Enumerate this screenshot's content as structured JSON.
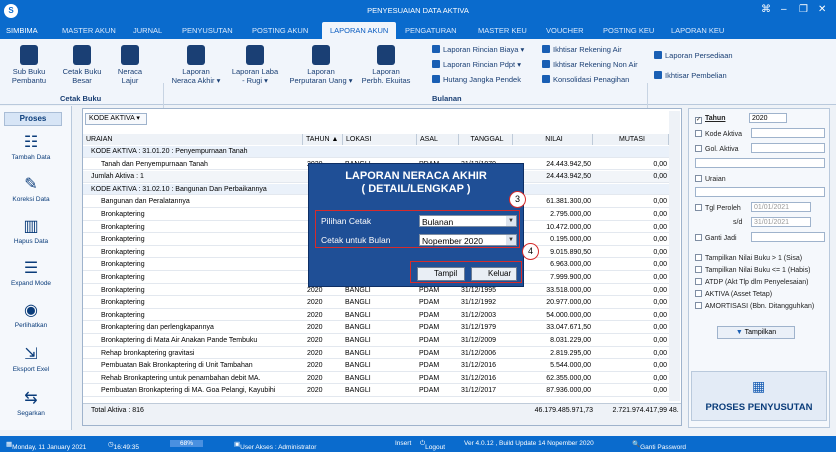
{
  "window": {
    "title": "PENYESUAIAN DATA AKTIVA",
    "logo": "S",
    "controls": [
      "⌘",
      "–",
      "❐",
      "✕"
    ]
  },
  "menu": [
    "SIMBIMA",
    "MASTER AKUN",
    "JURNAL",
    "PENYUSUTAN",
    "POSTING AKUN",
    "LAPORAN AKUN",
    "PENGATURAN",
    "MASTER KEU",
    "VOUCHER",
    "POSTING KEU",
    "LAPORAN KEU"
  ],
  "ribbon": {
    "buttons": [
      {
        "label": "Sub Buku\nPembantu"
      },
      {
        "label": "Cetak Buku\nBesar"
      },
      {
        "label": "Neraca\nLajur"
      },
      {
        "label": "Laporan\nNeraca Akhir ▾"
      },
      {
        "label": "Laporan Laba\n- Rugi ▾"
      },
      {
        "label": "Laporan\nPerputaran Uang ▾"
      },
      {
        "label": "Laporan\nPerbh. Ekuitas"
      }
    ],
    "group_cetak": "Cetak Buku",
    "group_bulanan": "Bulanan",
    "small": [
      "Laporan Rincian Biaya ▾",
      "Laporan Rincian Pdpt ▾",
      "Hutang Jangka Pendek",
      "Ikhtisar Rekening Air",
      "Ikhtisar Rekening Non Air",
      "Konsolidasi Penagihan",
      "Laporan Persediaan",
      "Ikhtisar Pembelian"
    ]
  },
  "left": {
    "title": "Proses",
    "buttons": [
      "Tambah Data",
      "Koreksi Data",
      "Hapus Data",
      "Expand Mode",
      "Perlihatkan",
      "Eksport Exel",
      "Segarkan"
    ]
  },
  "grid": {
    "group_by": "KODE AKTIVA",
    "headers": [
      "URAIAN",
      "TAHUN",
      "LOKASI",
      "ASAL",
      "TANGGAL",
      "NILAI",
      "MUTASI"
    ],
    "tahun_sort": "▲",
    "rows": [
      {
        "type": "group",
        "uraian": "KODE AKTIVA : 31.01.20 : Penyempurnaan Tanah"
      },
      {
        "type": "data",
        "uraian": "Tanah dan Penyempurnaan Tanah",
        "tahun": "2020",
        "lokasi": "BANGLI",
        "asal": "PDAM",
        "tanggal": "31/12/1979",
        "nilai": "24.443.942,50",
        "mutasi": "0,00"
      },
      {
        "type": "jml",
        "uraian": "Jumlah Aktiva : 1",
        "nilai": "24.443.942,50",
        "mutasi": "0,00"
      },
      {
        "type": "group",
        "uraian": "KODE AKTIVA : 31.02.10 : Bangunan Dan Perbaikannya"
      },
      {
        "type": "data",
        "uraian": "Bangunan dan Peralatannya",
        "nilai": "61.381.300,00",
        "mutasi": "0,00"
      },
      {
        "type": "data",
        "uraian": "Bronkaptering",
        "nilai": "2.795.000,00",
        "mutasi": "0,00"
      },
      {
        "type": "data",
        "uraian": "Bronkaptering",
        "nilai": "10.472.000,00",
        "mutasi": "0,00"
      },
      {
        "type": "data",
        "uraian": "Bronkaptering",
        "nilai": "0.195.000,00",
        "mutasi": "0,00"
      },
      {
        "type": "data",
        "uraian": "Bronkaptering",
        "nilai": "9.015.890,50",
        "mutasi": "0,00"
      },
      {
        "type": "data",
        "uraian": "Bronkaptering",
        "nilai": "6.963.000,00",
        "mutasi": "0,00"
      },
      {
        "type": "data",
        "uraian": "Bronkaptering",
        "nilai": "7.999.900,00",
        "mutasi": "0,00"
      },
      {
        "type": "data",
        "uraian": "Bronkaptering",
        "tahun": "2020",
        "lokasi": "BANGLI",
        "asal": "PDAM",
        "tanggal": "31/12/1995",
        "nilai": "33.518.000,00",
        "mutasi": "0,00"
      },
      {
        "type": "data",
        "uraian": "Bronkaptering",
        "tahun": "2020",
        "lokasi": "BANGLI",
        "asal": "PDAM",
        "tanggal": "31/12/1992",
        "nilai": "20.977.000,00",
        "mutasi": "0,00"
      },
      {
        "type": "data",
        "uraian": "Bronkaptering",
        "tahun": "2020",
        "lokasi": "BANGLI",
        "asal": "PDAM",
        "tanggal": "31/12/2003",
        "nilai": "54.000.000,00",
        "mutasi": "0,00"
      },
      {
        "type": "data",
        "uraian": "Bronkaptering dan perlengkapannya",
        "tahun": "2020",
        "lokasi": "BANGLI",
        "asal": "PDAM",
        "tanggal": "31/12/1979",
        "nilai": "33.047.671,50",
        "mutasi": "0,00"
      },
      {
        "type": "data",
        "uraian": "Bronkaptering di Mata Air Anakan Pande Tembuku",
        "tahun": "2020",
        "lokasi": "BANGLI",
        "asal": "PDAM",
        "tanggal": "31/12/2009",
        "nilai": "8.031.229,00",
        "mutasi": "0,00"
      },
      {
        "type": "data",
        "uraian": "Rehap bronkaptering gravitasi",
        "tahun": "2020",
        "lokasi": "BANGLI",
        "asal": "PDAM",
        "tanggal": "31/12/2006",
        "nilai": "2.819.295,00",
        "mutasi": "0,00"
      },
      {
        "type": "data",
        "uraian": "Pembuatan Bak Bronkaptering di Unit Tambahan",
        "tahun": "2020",
        "lokasi": "BANGLI",
        "asal": "PDAM",
        "tanggal": "31/12/2016",
        "nilai": "5.544.000,00",
        "mutasi": "0,00"
      },
      {
        "type": "data",
        "uraian": "Rehab Bronkaptering untuk penambahan debit MA.",
        "tahun": "2020",
        "lokasi": "BANGLI",
        "asal": "PDAM",
        "tanggal": "31/12/2016",
        "nilai": "62.355.000,00",
        "mutasi": "0,00"
      },
      {
        "type": "data",
        "uraian": "Pembuatan Bronkaptering di MA. Goa Pelangi, Kayubihi",
        "tahun": "2020",
        "lokasi": "BANGLI",
        "asal": "PDAM",
        "tanggal": "31/12/2017",
        "nilai": "87.936.000,00",
        "mutasi": "0,00"
      }
    ],
    "footer": {
      "total": "Total Aktiva : 816",
      "nilai": "46.179.485.971,73",
      "mutasi": "2.721.974.417,99",
      "extra": "48."
    }
  },
  "modal": {
    "title": "LAPORAN NERACA AKHIR\n( DETAIL/LENGKAP )",
    "label_cetak": "Pilihan Cetak",
    "value_cetak": "Bulanan",
    "label_bulan": "Cetak untuk Bulan",
    "value_bulan": "Nopember 2020",
    "btn_tampil": "Tampil",
    "btn_keluar": "Keluar",
    "callout_3": "3",
    "callout_4": "4"
  },
  "right": {
    "tahun_label": "Tahun",
    "tahun_value": "2020",
    "kode_aktiva": "Kode Aktiva",
    "gol_aktiva": "Gol. Aktiva",
    "uraian": "Uraian",
    "tgl_perolen": "Tgl Peroleh",
    "tgl_from": "01/01/2021",
    "sd": "s/d",
    "tgl_to": "31/01/2021",
    "ganti_jadi": "Ganti Jadi",
    "opts": [
      "Tampilkan Nilai Buku > 1 (Sisa)",
      "Tampilkan Nilai Buku <= 1 (Habis)",
      "ATDP (Akt Tlp dlm Penyelesaian)",
      "AKTIVA (Asset Tetap)",
      "AMORTISASI (Bbn. Ditangguhkan)"
    ],
    "btn_tampilkan": "Tampilkan",
    "proses": "PROSES PENYUSUTAN"
  },
  "status": {
    "date": "Monday, 11 January 2021",
    "time": "16:49:35",
    "pct": "68%",
    "user": "User Akses : Administrator",
    "insert": "Insert",
    "logout": "Logout",
    "version": "Ver 4.0.12 , Build Update 14 Nopember 2020",
    "ganti": "Ganti Password"
  },
  "colors": {
    "accent": "#0a6bcd",
    "dialog": "#1f4f96",
    "callout": "#d62b2b"
  }
}
